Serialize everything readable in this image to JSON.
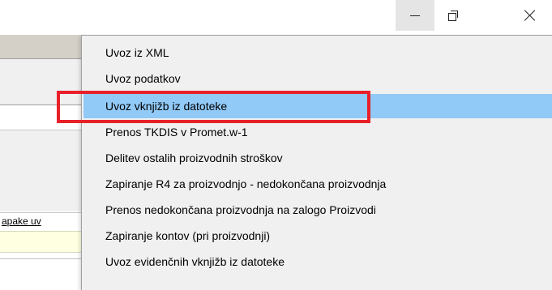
{
  "window_controls": {
    "minimize_icon": "minimize-icon",
    "maximize_icon": "restore-icon",
    "close_icon": "close-icon"
  },
  "background_app": {
    "column_label": "apake uv"
  },
  "menu": {
    "items": [
      {
        "label": "Uvoz iz  XML",
        "highlighted": false
      },
      {
        "label": "Uvoz podatkov",
        "highlighted": false
      },
      {
        "label": "Uvoz vknjižb iz datoteke",
        "highlighted": true
      },
      {
        "label": "Prenos TKDIS v Promet.w-1",
        "highlighted": false
      },
      {
        "label": "Delitev ostalih proizvodnih stroškov",
        "highlighted": false
      },
      {
        "label": "Zapiranje R4 za proizvodnjo - nedokončana proizvodnja",
        "highlighted": false
      },
      {
        "label": "Prenos nedokončana proizvodnja na zalogo Proizvodi",
        "highlighted": false
      },
      {
        "label": "Zapiranje kontov (pri proizvodnji)",
        "highlighted": false
      },
      {
        "label": "Uvoz evidenčnih vknjižb iz datoteke",
        "highlighted": false
      }
    ],
    "highlight_color": "#91c9f7",
    "annotation_color": "#e8202a"
  }
}
